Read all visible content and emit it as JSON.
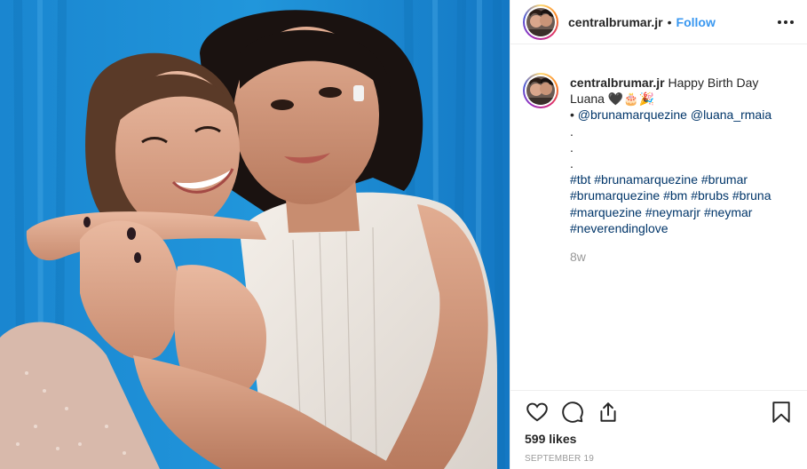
{
  "post": {
    "author": "centralbrumar.jr",
    "separator": "•",
    "follow_label": "Follow",
    "more_icon": "more-options-icon"
  },
  "caption": {
    "username": "centralbrumar.jr",
    "text_line1": "Happy Birth Day",
    "text_line2": "Luana",
    "emojis": "🖤🎂🎉",
    "bullet": "•",
    "mentions": [
      "@brunamarquezine",
      "@luana_rmaia"
    ],
    "dots": [
      ".",
      ".",
      "."
    ],
    "hashtags_line1": [
      "#tbt",
      "#brunamarquezine",
      "#brumar"
    ],
    "hashtags_line2": [
      "#brumarquezine",
      "#bm",
      "#brubs",
      "#bruna"
    ],
    "hashtags_line3": [
      "#marquezine",
      "#neymarjr",
      "#neymar"
    ],
    "hashtags_line4": [
      "#neverendinglove"
    ],
    "age": "8w"
  },
  "actions": {
    "like_icon": "heart-icon",
    "comment_icon": "comment-icon",
    "share_icon": "share-icon",
    "save_icon": "bookmark-icon"
  },
  "likes_text": "599 likes",
  "date_text": "September 19",
  "colors": {
    "link": "#003569",
    "follow": "#3897f0",
    "muted": "#999999",
    "background_photo": "#1e90d6"
  }
}
